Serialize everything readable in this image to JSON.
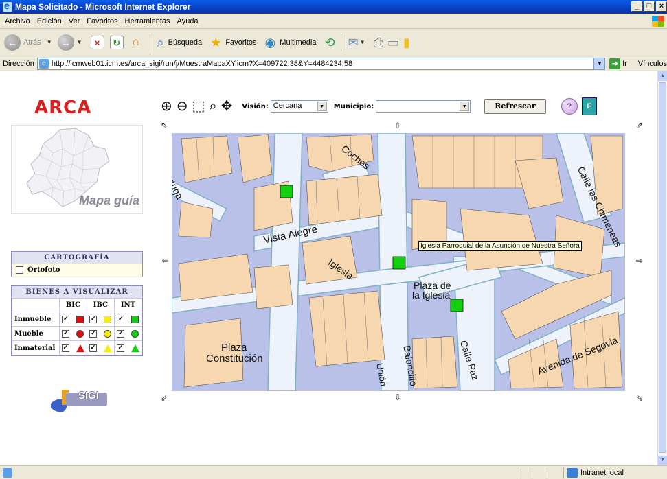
{
  "window": {
    "title": "Mapa Solicitado - Microsoft Internet Explorer",
    "btn_min": "_",
    "btn_max": "□",
    "btn_close": "×"
  },
  "menu": {
    "items": [
      "Archivo",
      "Edición",
      "Ver",
      "Favoritos",
      "Herramientas",
      "Ayuda"
    ]
  },
  "toolbar": {
    "back": "Atrás",
    "search": "Búsqueda",
    "favorites": "Favoritos",
    "multimedia": "Multimedia"
  },
  "address": {
    "label": "Dirección",
    "url": "http://icmweb01.icm.es/arca_sigi/run/j/MuestraMapaXY.icm?X=409722,38&Y=4484234,58",
    "go": "Ir",
    "links": "Vínculos"
  },
  "left": {
    "logo": "ARCA",
    "guide_label": "Mapa guía",
    "cartografia_title": "CARTOGRAFÍA",
    "ortofoto_label": "Ortofoto",
    "bienes_title": "BIENES A VISUALIZAR",
    "columns": [
      "BIC",
      "IBC",
      "INT"
    ],
    "rows": [
      {
        "label": "Inmueble",
        "shape": "square"
      },
      {
        "label": "Mueble",
        "shape": "circle"
      },
      {
        "label": "Inmaterial",
        "shape": "triangle"
      }
    ],
    "column_colors": [
      "#e01010",
      "#f8f000",
      "#10d010"
    ],
    "sigi_logo": "SIGI"
  },
  "map_toolbar": {
    "vision_label": "Visión:",
    "vision_value": "Cercana",
    "municipio_label": "Municipio:",
    "municipio_value": "",
    "refresh_label": "Refrescar",
    "help_glyph": "?",
    "exit_glyph": "F"
  },
  "map": {
    "tooltip": "Iglesia Parroquial de la Asunción de Nuestra Señora",
    "marker_color": "#10d010",
    "labels": {
      "tortuga": "Tortuga",
      "coches": "Coches",
      "vista_alegre": "Vista Alegre",
      "iglesia": "Iglesia",
      "plaza_iglesia_1": "Plaza de",
      "plaza_iglesia_2": "la Iglesia",
      "calle_chimeneas": "Calle las Chimeneas",
      "avenida_segovia": "Avenida de Segovia",
      "calle_paz": "Calle Paz",
      "plaza_constitucion_1": "Plaza",
      "plaza_constitucion_2": "Constitución",
      "baloncillo": "Baloncillo",
      "union": "Unión"
    }
  },
  "status": {
    "zone": "Intranet local"
  }
}
